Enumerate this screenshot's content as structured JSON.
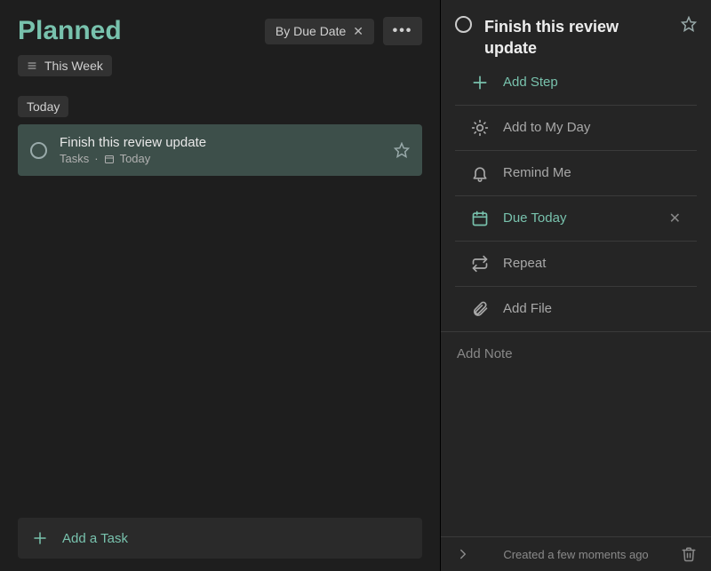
{
  "header": {
    "title": "Planned",
    "sort_label": "By Due Date",
    "filter_label": "This Week"
  },
  "groups": [
    {
      "label": "Today"
    }
  ],
  "tasks": [
    {
      "title": "Finish this review update",
      "list": "Tasks",
      "due_label": "Today"
    }
  ],
  "add_task_placeholder": "Add a Task",
  "detail": {
    "title": "Finish this review update",
    "add_step_label": "Add Step",
    "add_my_day_label": "Add to My Day",
    "remind_label": "Remind Me",
    "due_label": "Due Today",
    "repeat_label": "Repeat",
    "add_file_label": "Add File",
    "note_placeholder": "Add Note",
    "created_label": "Created a few moments ago"
  }
}
